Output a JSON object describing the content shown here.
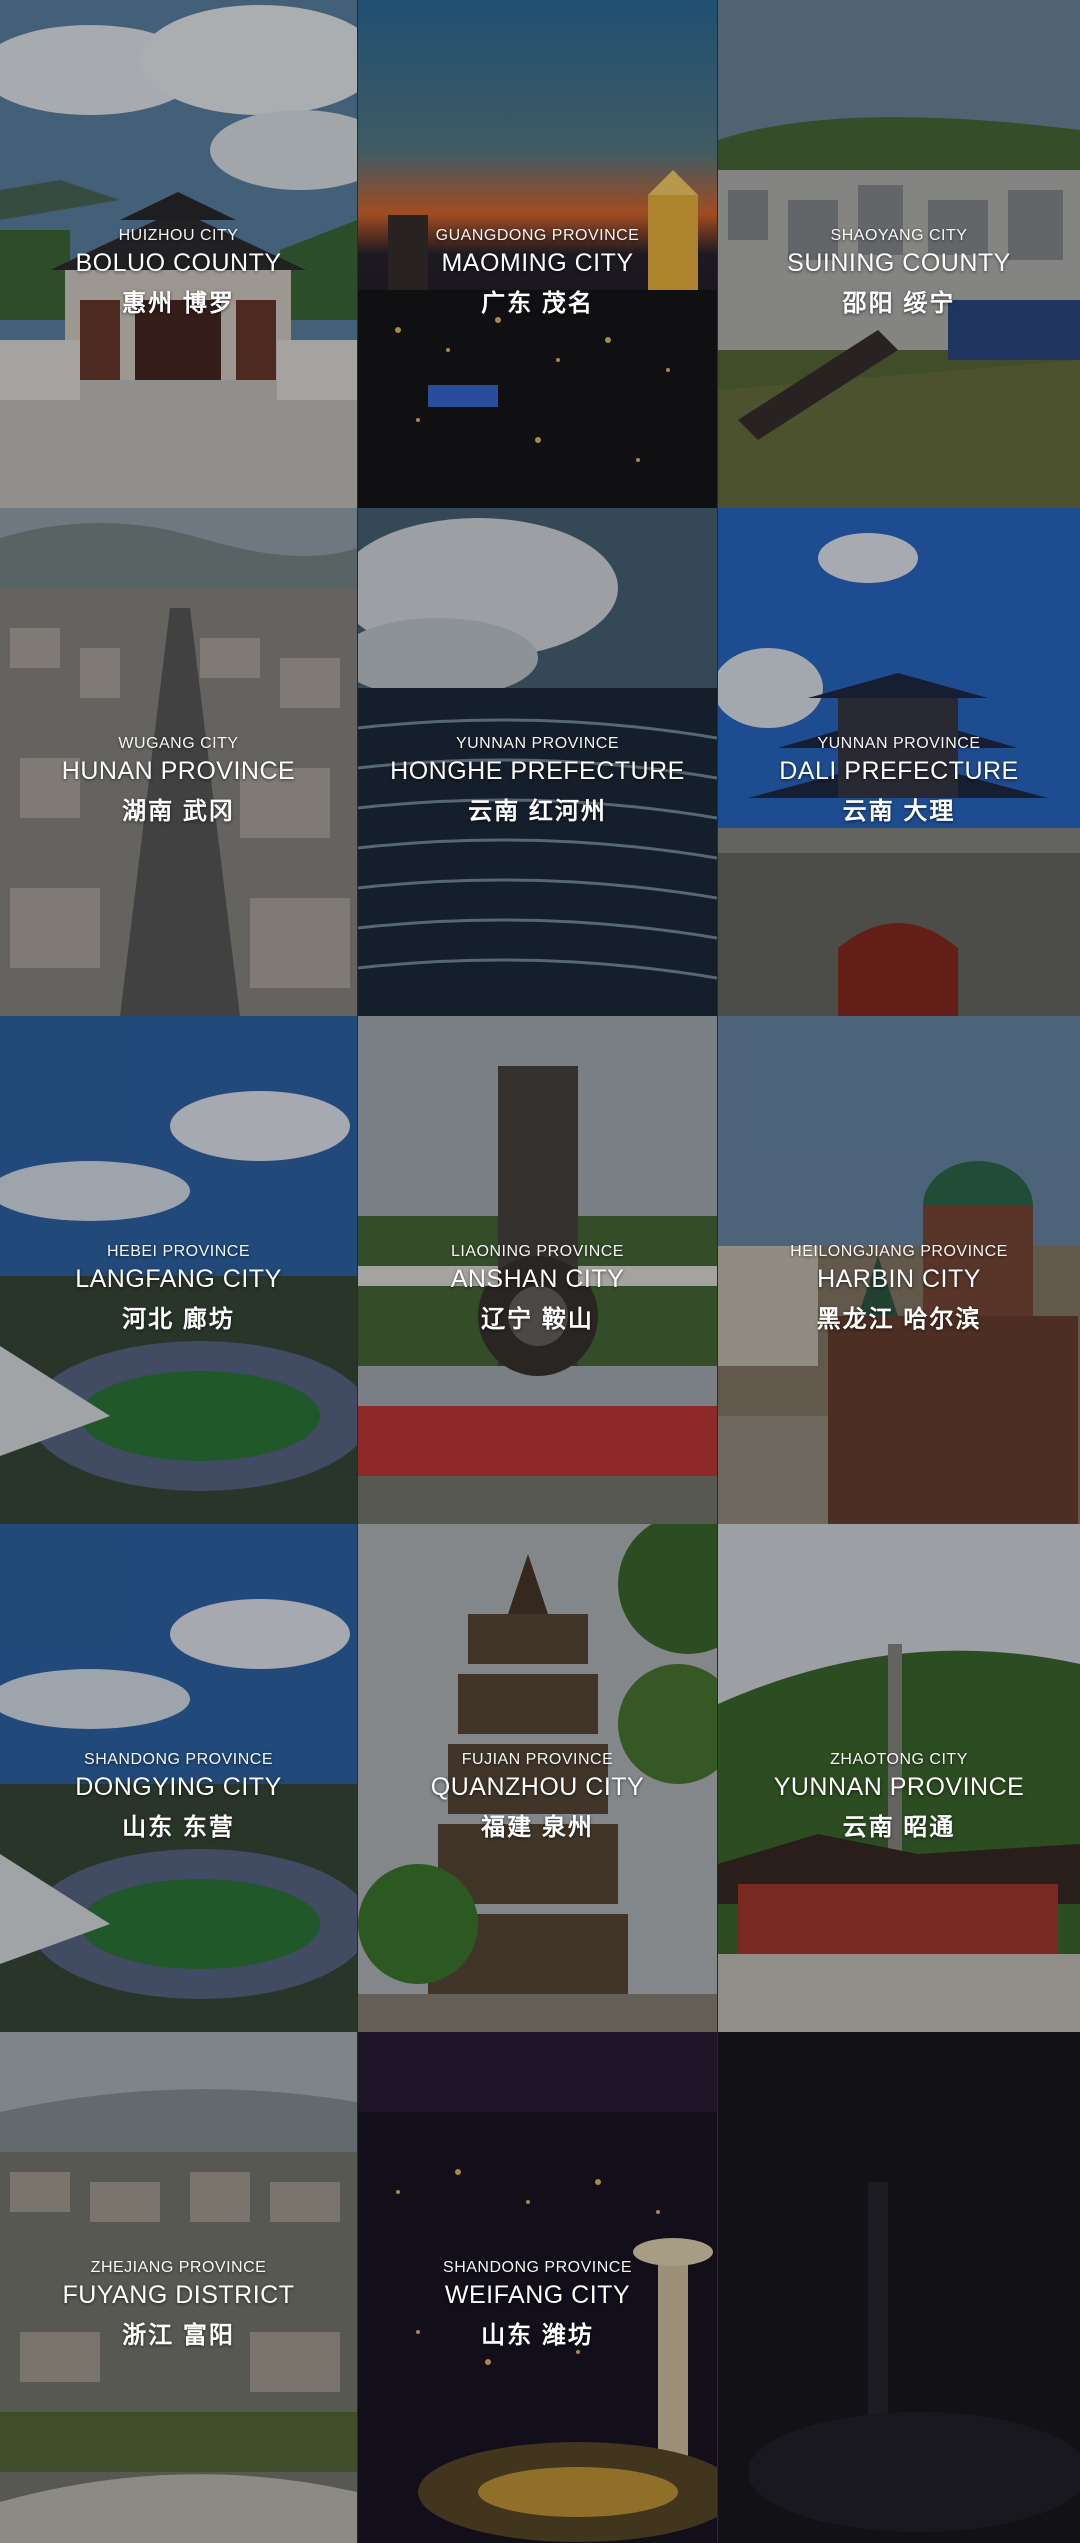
{
  "tiles": [
    {
      "sub": "HUIZHOU CITY",
      "main": "BOLUO COUNTY",
      "cn": "惠州 博罗"
    },
    {
      "sub": "GUANGDONG PROVINCE",
      "main": "MAOMING CITY",
      "cn": "广东 茂名"
    },
    {
      "sub": "SHAOYANG CITY",
      "main": "SUINING COUNTY",
      "cn": "邵阳 绥宁"
    },
    {
      "sub": "WUGANG CITY",
      "main": "HUNAN PROVINCE",
      "cn": "湖南 武冈"
    },
    {
      "sub": "YUNNAN PROVINCE",
      "main": "HONGHE PREFECTURE",
      "cn": "云南 红河州"
    },
    {
      "sub": "YUNNAN PROVINCE",
      "main": "DALI PREFECTURE",
      "cn": "云南 大理"
    },
    {
      "sub": "HEBEI PROVINCE",
      "main": "LANGFANG CITY",
      "cn": "河北 廊坊"
    },
    {
      "sub": "LIAONING PROVINCE",
      "main": "ANSHAN CITY",
      "cn": "辽宁 鞍山"
    },
    {
      "sub": "HEILONGJIANG PROVINCE",
      "main": "HARBIN CITY",
      "cn": "黑龙江 哈尔滨"
    },
    {
      "sub": "SHANDONG PROVINCE",
      "main": "DONGYING CITY",
      "cn": "山东 东营"
    },
    {
      "sub": "FUJIAN PROVINCE",
      "main": "QUANZHOU CITY",
      "cn": "福建 泉州"
    },
    {
      "sub": "ZHAOTONG CITY",
      "main": "YUNNAN PROVINCE",
      "cn": "云南 昭通"
    },
    {
      "sub": "ZHEJIANG PROVINCE",
      "main": "FUYANG DISTRICT",
      "cn": "浙江 富阳"
    },
    {
      "sub": "SHANDONG PROVINCE",
      "main": "WEIFANG CITY",
      "cn": "山东 潍坊"
    }
  ]
}
